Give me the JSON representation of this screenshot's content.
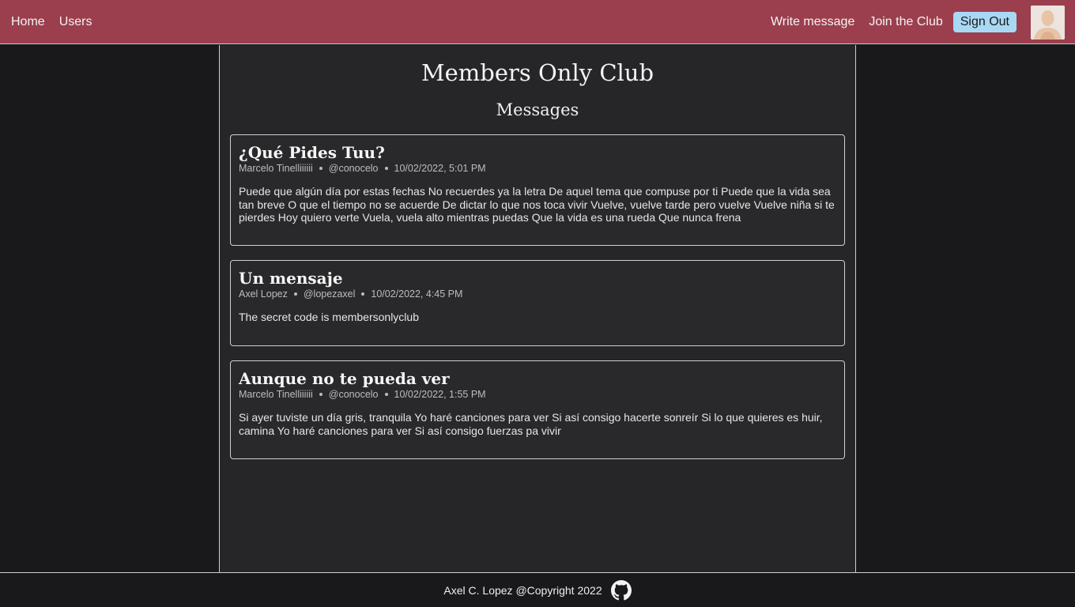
{
  "nav": {
    "home": "Home",
    "users": "Users",
    "write_message": "Write message",
    "join_club": "Join the Club",
    "sign_out": "Sign Out",
    "avatar_icon": "user-avatar-icon"
  },
  "page": {
    "title": "Members Only Club",
    "section_title": "Messages"
  },
  "messages": [
    {
      "title": "¿Qué Pides Tuu?",
      "author": "Marcelo Tinelliiiiii",
      "username": "@conocelo",
      "date": "10/02/2022, 5:01 PM",
      "body": "Puede que algún día por estas fechas No recuerdes ya la letra De aquel tema que compuse por ti Puede que la vida sea tan breve O que el tiempo no se acuerde De dictar lo que nos toca vivir Vuelve, vuelve tarde pero vuelve Vuelve niña si te pierdes Hoy quiero verte Vuela, vuela alto mientras puedas Que la vida es una rueda Que nunca frena"
    },
    {
      "title": "Un mensaje",
      "author": "Axel Lopez",
      "username": "@lopezaxel",
      "date": "10/02/2022, 4:45 PM",
      "body": "The secret code is membersonlyclub"
    },
    {
      "title": "Aunque no te pueda ver",
      "author": "Marcelo Tinelliiiiii",
      "username": "@conocelo",
      "date": "10/02/2022, 1:55 PM",
      "body": "Si ayer tuviste un día gris, tranquila Yo haré canciones para ver Si así consigo hacerte sonreír Si lo que quieres es huir, camina Yo haré canciones para ver Si así consigo fuerzas pa vivir"
    }
  ],
  "footer": {
    "text": "Axel C. Lopez @Copyright 2022",
    "icon": "github-icon"
  },
  "colors": {
    "navbar": "#9b3f4e",
    "signout": "#a8d8f4",
    "background": "#19191b",
    "panel": "#262628"
  }
}
